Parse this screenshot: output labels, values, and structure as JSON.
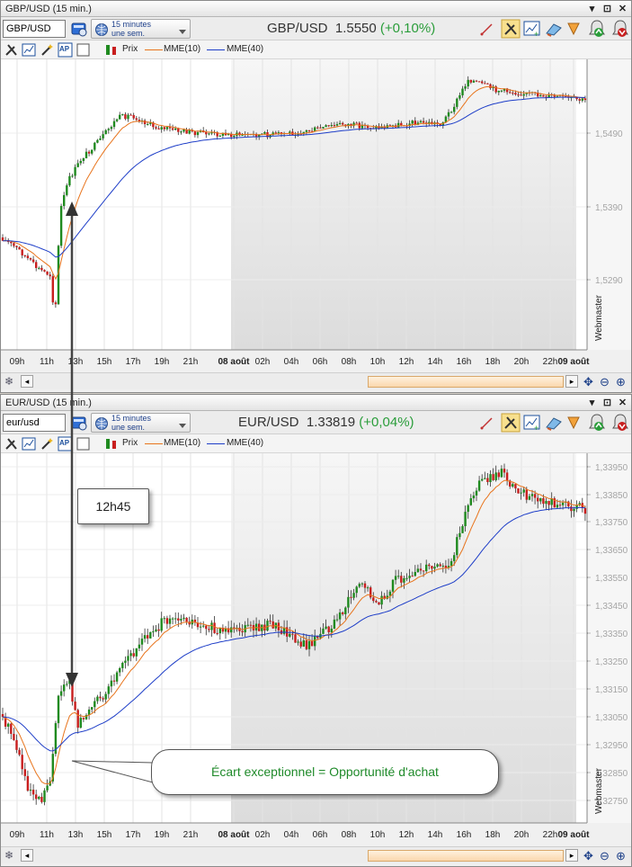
{
  "charts": [
    {
      "title": "GBP/USD (15 min.)",
      "symbol": "GBP/USD",
      "header": {
        "name": "GBP/USD",
        "price": "1.5550",
        "change": "(+0,10%)"
      },
      "timeframe": {
        "line1": "15 minutes",
        "line2": "une sem."
      },
      "legend": {
        "price": "Prix",
        "ema10": "MME(10)",
        "ema40": "MME(40)"
      },
      "y_ticks": [
        "1,5490",
        "1,5390",
        "1,5290"
      ],
      "x_ticks": [
        "09h",
        "11h",
        "13h",
        "15h",
        "17h",
        "19h",
        "21h",
        "08 août",
        "02h",
        "04h",
        "06h",
        "08h",
        "10h",
        "12h",
        "14h",
        "16h",
        "18h",
        "20h",
        "22h",
        "09 août"
      ],
      "watermark": "Webmaster"
    },
    {
      "title": "EUR/USD (15 min.)",
      "symbol": "eur/usd",
      "header": {
        "name": "EUR/USD",
        "price": "1.33819",
        "change": "(+0,04%)"
      },
      "timeframe": {
        "line1": "15 minutes",
        "line2": "une sem."
      },
      "legend": {
        "price": "Prix",
        "ema10": "MME(10)",
        "ema40": "MME(40)"
      },
      "y_ticks": [
        "1,33950",
        "1,33850",
        "1,33750",
        "1,33650",
        "1,33550",
        "1,33450",
        "1,33350",
        "1,33250",
        "1,33150",
        "1,33050",
        "1,32950",
        "1,32850",
        "1,32750"
      ],
      "x_ticks": [
        "09h",
        "11h",
        "13h",
        "15h",
        "17h",
        "19h",
        "21h",
        "08 août",
        "02h",
        "04h",
        "06h",
        "08h",
        "10h",
        "12h",
        "14h",
        "16h",
        "18h",
        "20h",
        "22h",
        "09 août"
      ],
      "watermark": "Webmaster"
    }
  ],
  "annotations": {
    "time_callout": "12h45",
    "note_callout": "Écart exceptionnel = Opportunité d'achat"
  },
  "colors": {
    "bull_candle": "#1f8a1f",
    "bear_candle": "#c81e1e",
    "ema10": "#e8741c",
    "ema40": "#1e3ec8",
    "note_text": "#1f8a2a",
    "change_text": "#2a9d3a"
  },
  "icons": [
    "book-icon",
    "globe-icon",
    "pencil-icon",
    "tools-icon",
    "chart-add-icon",
    "paint-icon",
    "pen-icon",
    "alert-up-icon",
    "alert-down-icon",
    "move-icon",
    "zoom-out-icon",
    "zoom-in-icon",
    "snowflake-icon"
  ]
}
